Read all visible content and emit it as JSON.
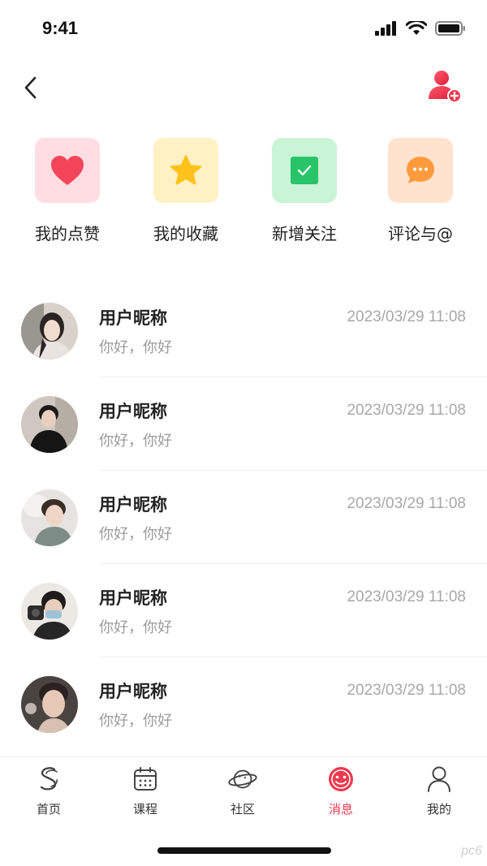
{
  "status_bar": {
    "time": "9:41"
  },
  "header": {
    "back_icon": "chevron-left-icon",
    "add_friend_icon": "add-user-icon",
    "accent": "#f0394d"
  },
  "quick_entries": [
    {
      "label": "我的点赞",
      "icon": "heart-icon",
      "tile_color": "#ffd9de",
      "icon_color": "#f2455a"
    },
    {
      "label": "我的收藏",
      "icon": "star-icon",
      "tile_color": "#fff0c0",
      "icon_color": "#ffc21a"
    },
    {
      "label": "新增关注",
      "icon": "check-square-icon",
      "tile_color": "#c9f5d6",
      "icon_color": "#28c468"
    },
    {
      "label": "评论与@",
      "icon": "comment-icon",
      "tile_color": "#ffe3cf",
      "icon_color": "#ff9a3d"
    }
  ],
  "messages": [
    {
      "name": "用户昵称",
      "time": "2023/03/29 11:08",
      "preview": "你好，你好"
    },
    {
      "name": "用户昵称",
      "time": "2023/03/29 11:08",
      "preview": "你好，你好"
    },
    {
      "name": "用户昵称",
      "time": "2023/03/29 11:08",
      "preview": "你好，你好"
    },
    {
      "name": "用户昵称",
      "time": "2023/03/29 11:08",
      "preview": "你好，你好"
    },
    {
      "name": "用户昵称",
      "time": "2023/03/29 11:08",
      "preview": "你好，你好"
    }
  ],
  "tabs": [
    {
      "label": "首页",
      "icon": "home-logo-icon",
      "active": false
    },
    {
      "label": "课程",
      "icon": "calendar-icon",
      "active": false
    },
    {
      "label": "社区",
      "icon": "planet-icon",
      "active": false
    },
    {
      "label": "消息",
      "icon": "message-smile-icon",
      "active": true
    },
    {
      "label": "我的",
      "icon": "user-icon",
      "active": false
    }
  ],
  "watermark": "pc6"
}
